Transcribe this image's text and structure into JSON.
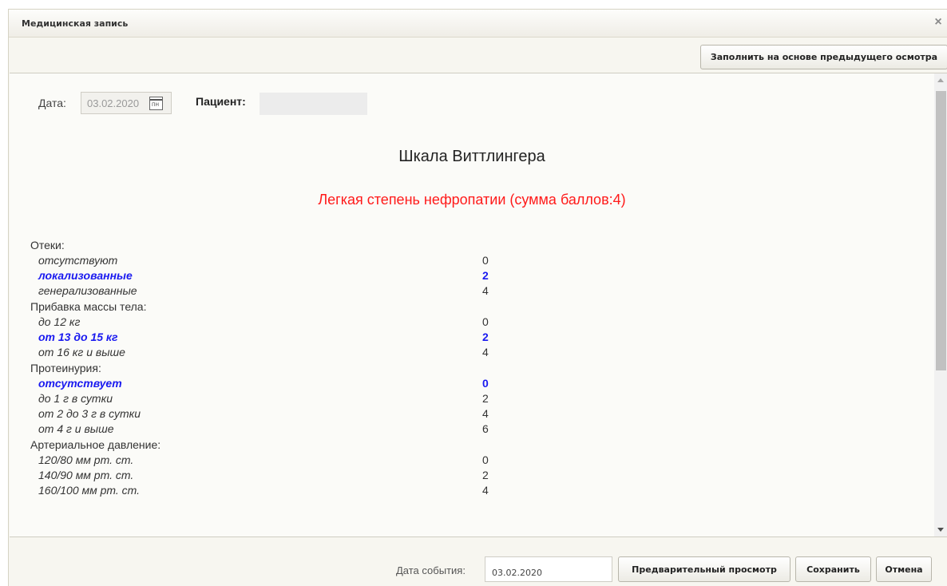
{
  "dialog": {
    "title": "Медицинская запись",
    "close_glyph": "×",
    "prefill_button": "Заполнить на основе предыдущего осмотра"
  },
  "form": {
    "date_label": "Дата:",
    "date_value": "03.02.2020",
    "calendar_icon_text": "ПН",
    "patient_label": "Пациент:",
    "heading": "Шкала Виттлингера",
    "result": "Легкая степень нефропатии (сумма баллов:4)"
  },
  "groups": [
    {
      "title": "Отеки:",
      "options": [
        {
          "label": "отсутствуют",
          "score": "0",
          "selected": false
        },
        {
          "label": "локализованные",
          "score": "2",
          "selected": true
        },
        {
          "label": "генерализованные",
          "score": "4",
          "selected": false
        }
      ]
    },
    {
      "title": "Прибавка массы тела:",
      "options": [
        {
          "label": "до 12 кг",
          "score": "0",
          "selected": false
        },
        {
          "label": "от 13 до 15 кг",
          "score": "2",
          "selected": true
        },
        {
          "label": "от 16 кг и выше",
          "score": "4",
          "selected": false
        }
      ]
    },
    {
      "title": "Протеинурия:",
      "options": [
        {
          "label": "отсутствует",
          "score": "0",
          "selected": true
        },
        {
          "label": "до 1 г в сутки",
          "score": "2",
          "selected": false
        },
        {
          "label": "от 2 до 3 г в сутки",
          "score": "4",
          "selected": false
        },
        {
          "label": "от 4 г и выше",
          "score": "6",
          "selected": false
        }
      ]
    },
    {
      "title": "Артериальное давление:",
      "options": [
        {
          "label": "120/80 мм рт. ст.",
          "score": "0",
          "selected": false
        },
        {
          "label": "140/90 мм рт. ст.",
          "score": "2",
          "selected": false
        },
        {
          "label": "160/100 мм рт. ст.",
          "score": "4",
          "selected": false
        }
      ]
    }
  ],
  "footer": {
    "event_date_label": "Дата события:",
    "event_date_value": "03.02.2020",
    "preview_button": "Предварительный просмотр",
    "save_button": "Сохранить",
    "cancel_button": "Отмена"
  },
  "colors": {
    "result_text": "#ff1a1a",
    "selected_option": "#1a1af0"
  }
}
